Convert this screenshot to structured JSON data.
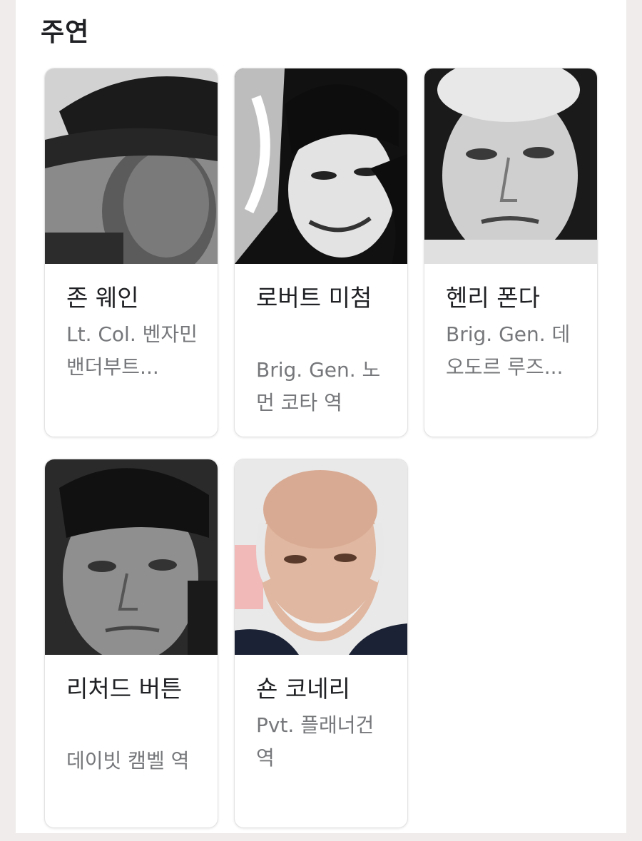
{
  "section": {
    "title": "주연"
  },
  "cast": [
    {
      "name": "존 웨인",
      "role": "Lt. Col. 벤자민 밴더부트..."
    },
    {
      "name": "로버트 미첨",
      "role": "Brig. Gen. 노먼 코타 역"
    },
    {
      "name": "헨리 폰다",
      "role": "Brig. Gen. 데오도르 루즈..."
    },
    {
      "name": "리처드 버튼",
      "role": "데이빗 캠벨 역"
    },
    {
      "name": "숀 코네리",
      "role": "Pvt. 플래너건 역"
    }
  ]
}
